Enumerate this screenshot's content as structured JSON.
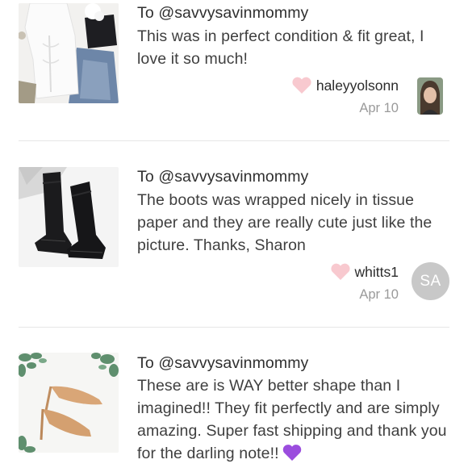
{
  "reviews": [
    {
      "to": "To @savvysavinmommy",
      "message": "This was in perfect condition & fit great, I love it so much!",
      "username": "haleyyolsonn",
      "date": "Apr 10",
      "thumbnail_icon": "white-top-photo",
      "avatar_icon": "user-photo-avatar"
    },
    {
      "to": "To @savvysavinmommy",
      "message": "The boots was wrapped nicely in tissue paper and they are really cute just like the picture. Thanks, Sharon",
      "username": "whitts1",
      "date": "Apr 10",
      "thumbnail_icon": "black-boots-photo",
      "avatar_initials": "SA"
    },
    {
      "to": "To @savvysavinmommy",
      "message": "These are is WAY better shape than I imagined!! They fit perfectly and are simply amazing. Super fast shipping and thank you for the darling note!!",
      "thumbnail_icon": "nude-heels-photo",
      "emoji": "purple-heart"
    }
  ],
  "colors": {
    "heart": "#f8c9cf",
    "avatar_bg": "#c8c8c8",
    "purple_heart": "#9b4dde",
    "divider": "#e6e6e6"
  }
}
